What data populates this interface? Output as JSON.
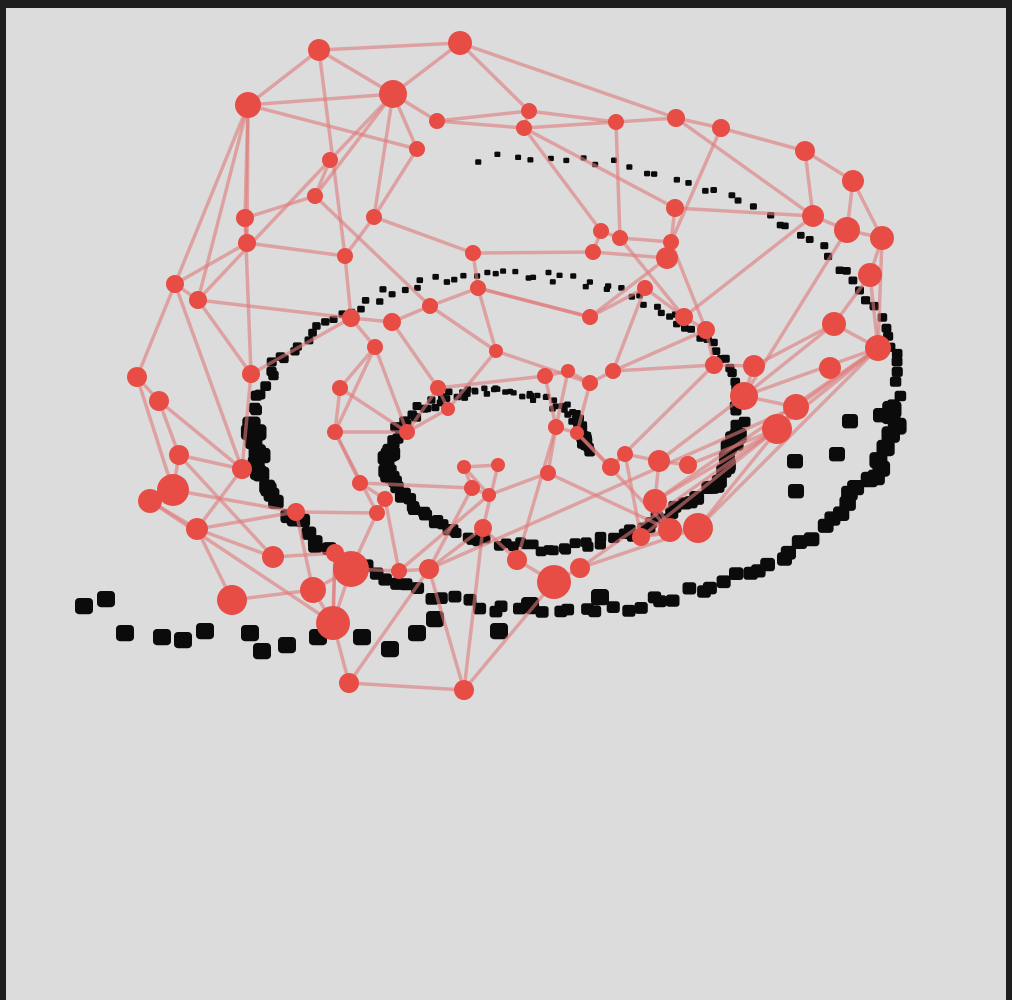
{
  "colors": {
    "frame": "#1e1e1e",
    "background": "#dcdcdc",
    "point_cloud": "#0b0b0b",
    "graph_node": "#e74c45",
    "graph_edge": "#e07a7a"
  },
  "scene": {
    "view": "3d-point-cloud-with-graph-overlay",
    "point_cloud_shape": "spiral",
    "graph_node_count": 96,
    "point_cloud_count": 340
  }
}
